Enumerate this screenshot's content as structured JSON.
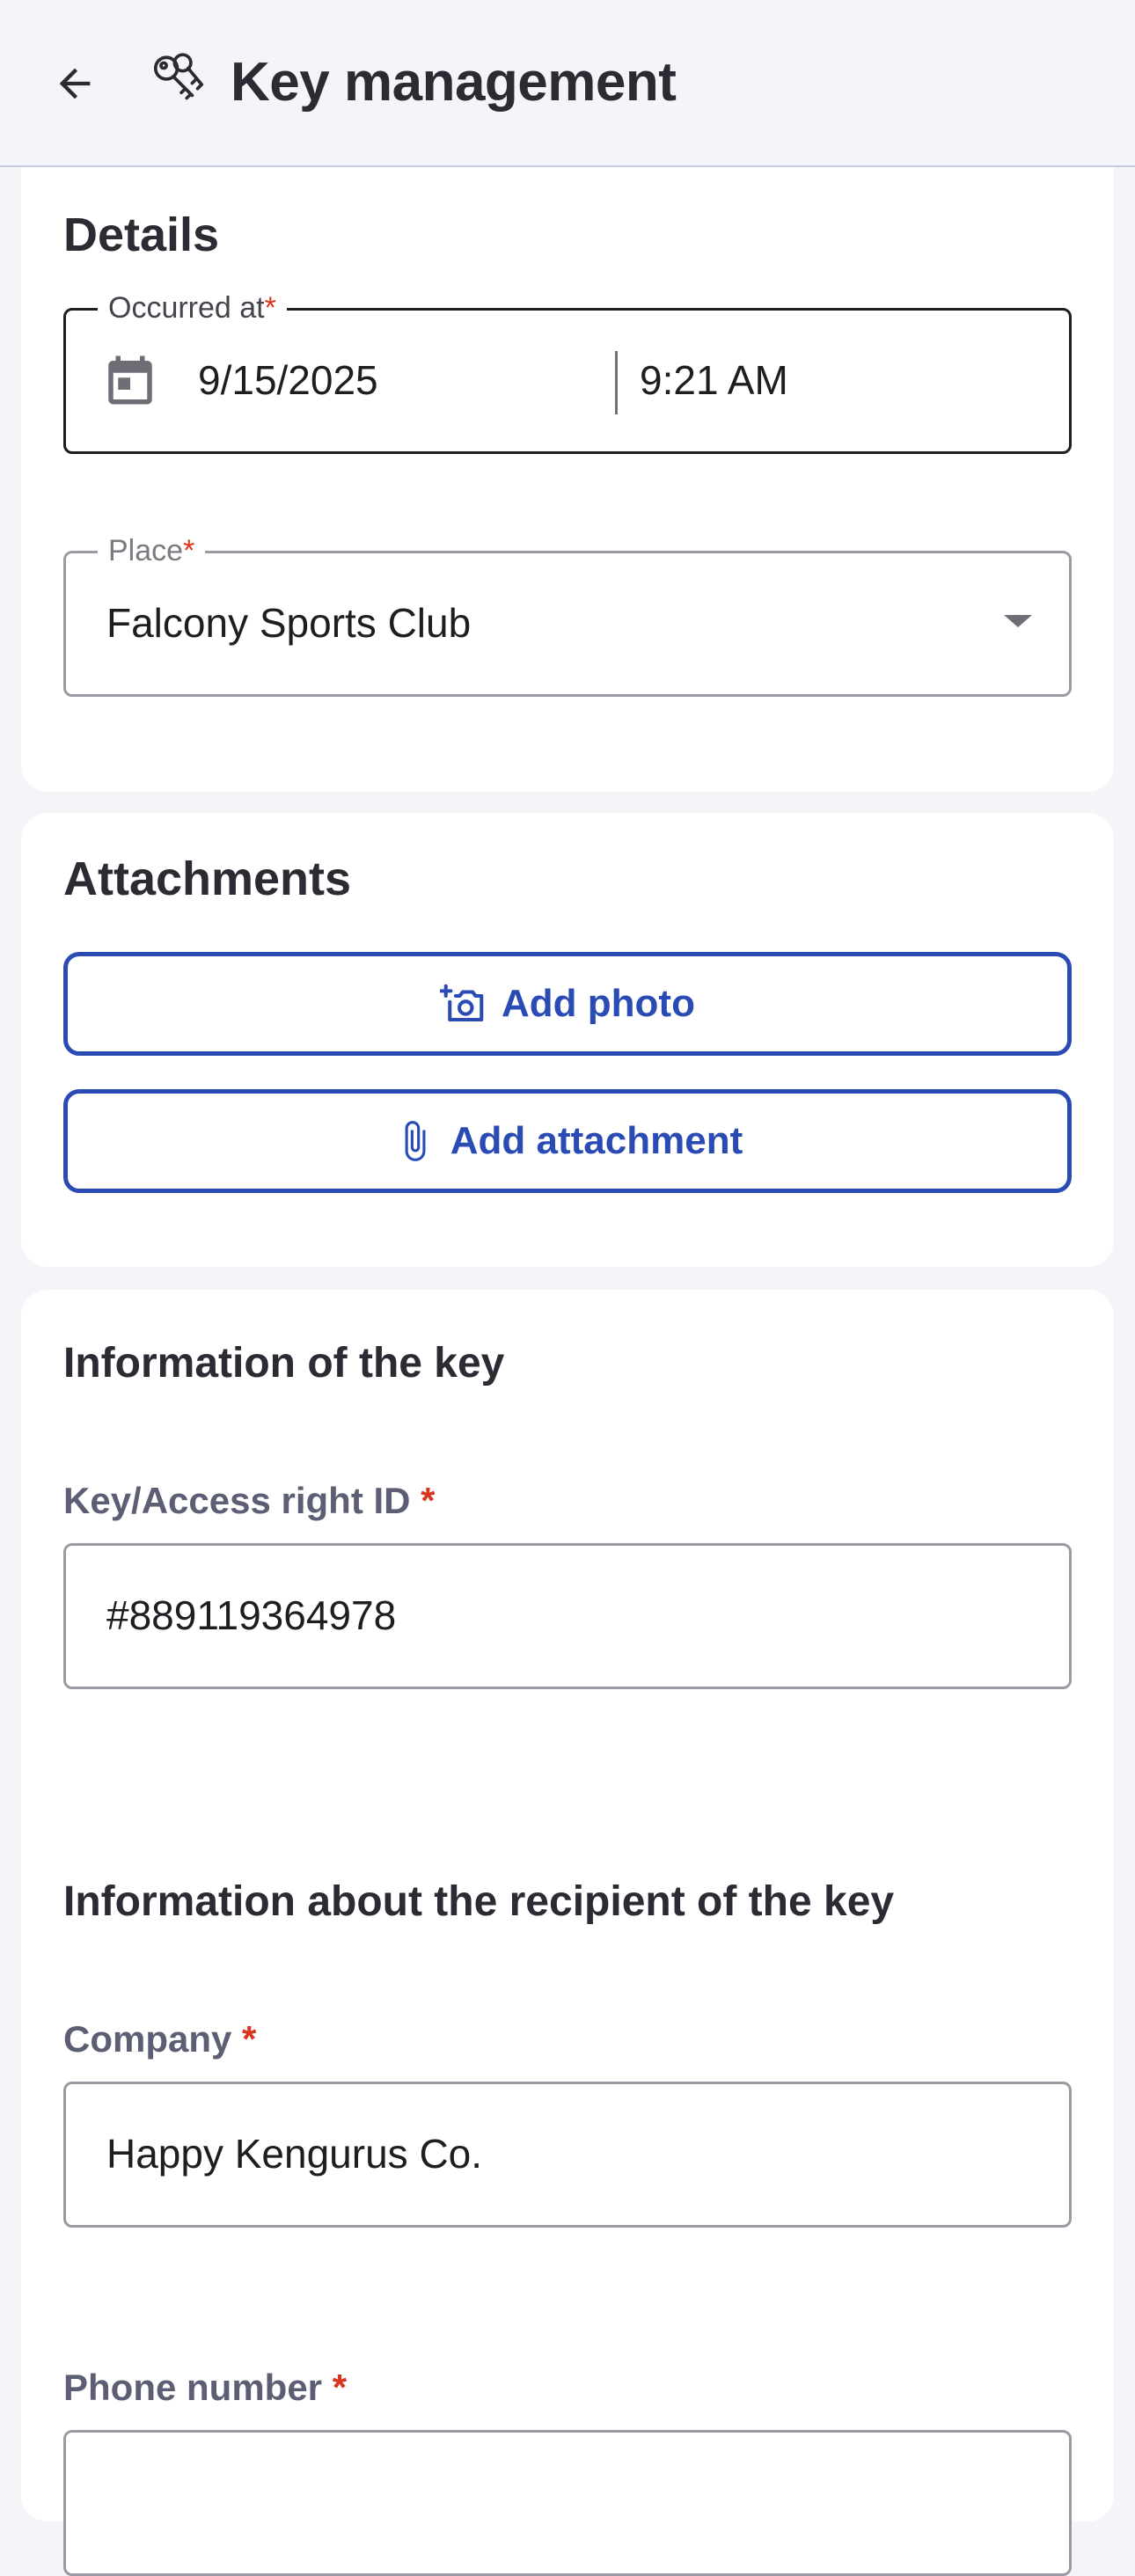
{
  "header": {
    "title": "Key management",
    "back_icon": "arrow-left-icon",
    "app_icon": "keys-icon"
  },
  "details": {
    "title": "Details",
    "occurred_at": {
      "label": "Occurred at",
      "required_mark": "*",
      "date": "9/15/2025",
      "time": "9:21 AM",
      "icon": "calendar-icon"
    },
    "place": {
      "label": "Place",
      "required_mark": "*",
      "value": "Falcony Sports Club",
      "icon": "dropdown-arrow-icon"
    }
  },
  "attachments": {
    "title": "Attachments",
    "add_photo": "Add photo",
    "add_attachment": "Add attachment"
  },
  "key_info": {
    "title": "Information of the key",
    "key_id_label": "Key/Access right ID",
    "required_mark": "*",
    "key_id_value": "#889119364978"
  },
  "recipient": {
    "title": "Information about the recipient of the key",
    "company_label": "Company",
    "company_value": "Happy Kengurus Co.",
    "phone_label": "Phone number",
    "required_mark": "*"
  },
  "colors": {
    "accent": "#2a4bb3",
    "required": "#d8341e",
    "background": "#f3f5f9"
  }
}
